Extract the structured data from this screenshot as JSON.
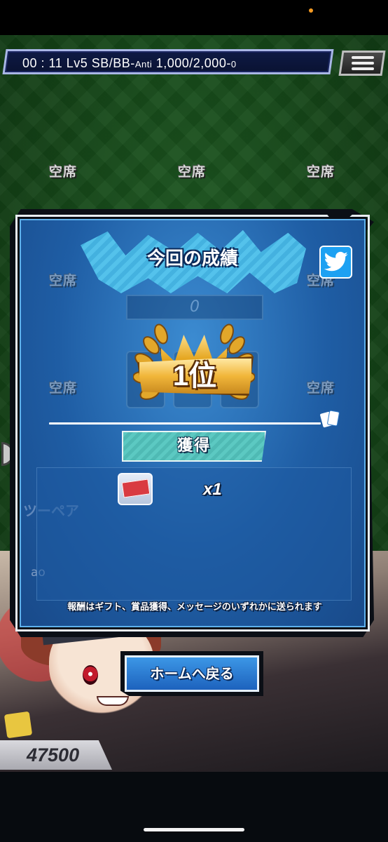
{
  "status_bar": {
    "dot_color": "#f59b23"
  },
  "header": {
    "time": "00 : 11",
    "level": "Lv5",
    "blinds_label": "SB/BB-",
    "ante_label": "Anti",
    "blinds_value": "1,000/2,000-",
    "ante_value": "0",
    "menu_icon": "hamburger-menu-icon"
  },
  "seats": {
    "empty_label": "空席"
  },
  "background_table": {
    "pot_value": "0",
    "hand_name": "ツーペア",
    "player_name": "ao",
    "player_score": "47500"
  },
  "result_dialog": {
    "title": "今回の成績",
    "share_icon": "twitter-bird-icon",
    "rank_label": "1位",
    "acquire_label": "獲得",
    "rewards": [
      {
        "icon": "ticket-icon",
        "quantity": "x1"
      }
    ],
    "notice": "報酬はギフト、賞品獲得、メッセージのいずれかに送られます",
    "home_button_label": "ホームへ戻る"
  },
  "colors": {
    "table_green": "#174a1a",
    "dialog_blue": "#2a78c8",
    "accent_gold": "#f1b63a",
    "twitter_blue": "#1da1f2"
  }
}
